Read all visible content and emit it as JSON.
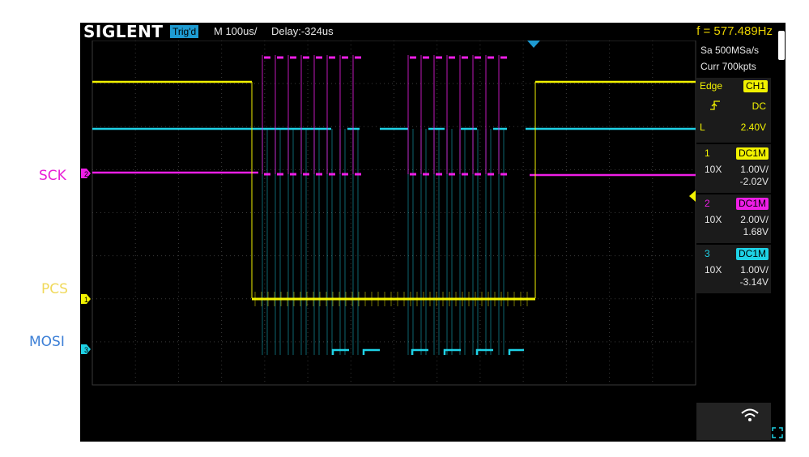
{
  "labels": {
    "sck": "SCK",
    "pcs": "PCS",
    "mosi": "MOSI",
    "sck_color": "#e81ed6",
    "pcs_color": "#f0d95a",
    "mosi_color": "#3c7fd6"
  },
  "topbar": {
    "brand": "SIGLENT",
    "trig_status": "Trig'd",
    "timebase": "M 100us/",
    "delay": "Delay:-324us",
    "frequency": "f = 577.489Hz"
  },
  "acquisition": {
    "sample_rate": "Sa 500MSa/s",
    "memory_depth": "Curr 700kpts"
  },
  "trigger": {
    "type": "Edge",
    "source": "CH1",
    "slope_icon": "rising-edge-icon",
    "coupling": "DC",
    "level_prefix": "L",
    "level": "2.40V"
  },
  "channels": [
    {
      "number": "1",
      "coupling": "DC1M",
      "probe": "10X",
      "scale": "1.00V/",
      "offset": "-2.02V",
      "color": "#f2f200"
    },
    {
      "number": "2",
      "coupling": "DC1M",
      "probe": "10X",
      "scale": "2.00V/",
      "offset": "1.68V",
      "color": "#ee1ee6"
    },
    {
      "number": "3",
      "coupling": "DC1M",
      "probe": "10X",
      "scale": "1.00V/",
      "offset": "-3.14V",
      "color": "#1ed2e6"
    }
  ],
  "colors": {
    "ch1": "#f2f200",
    "ch2": "#ee1ee6",
    "ch3": "#1ed2e6",
    "grid": "#3a3a3a",
    "trigger_marker": "#1e9bd2",
    "background": "#000000"
  },
  "icons": {
    "wifi": "wifi-icon",
    "fullscreen": "fullscreen-icon"
  }
}
